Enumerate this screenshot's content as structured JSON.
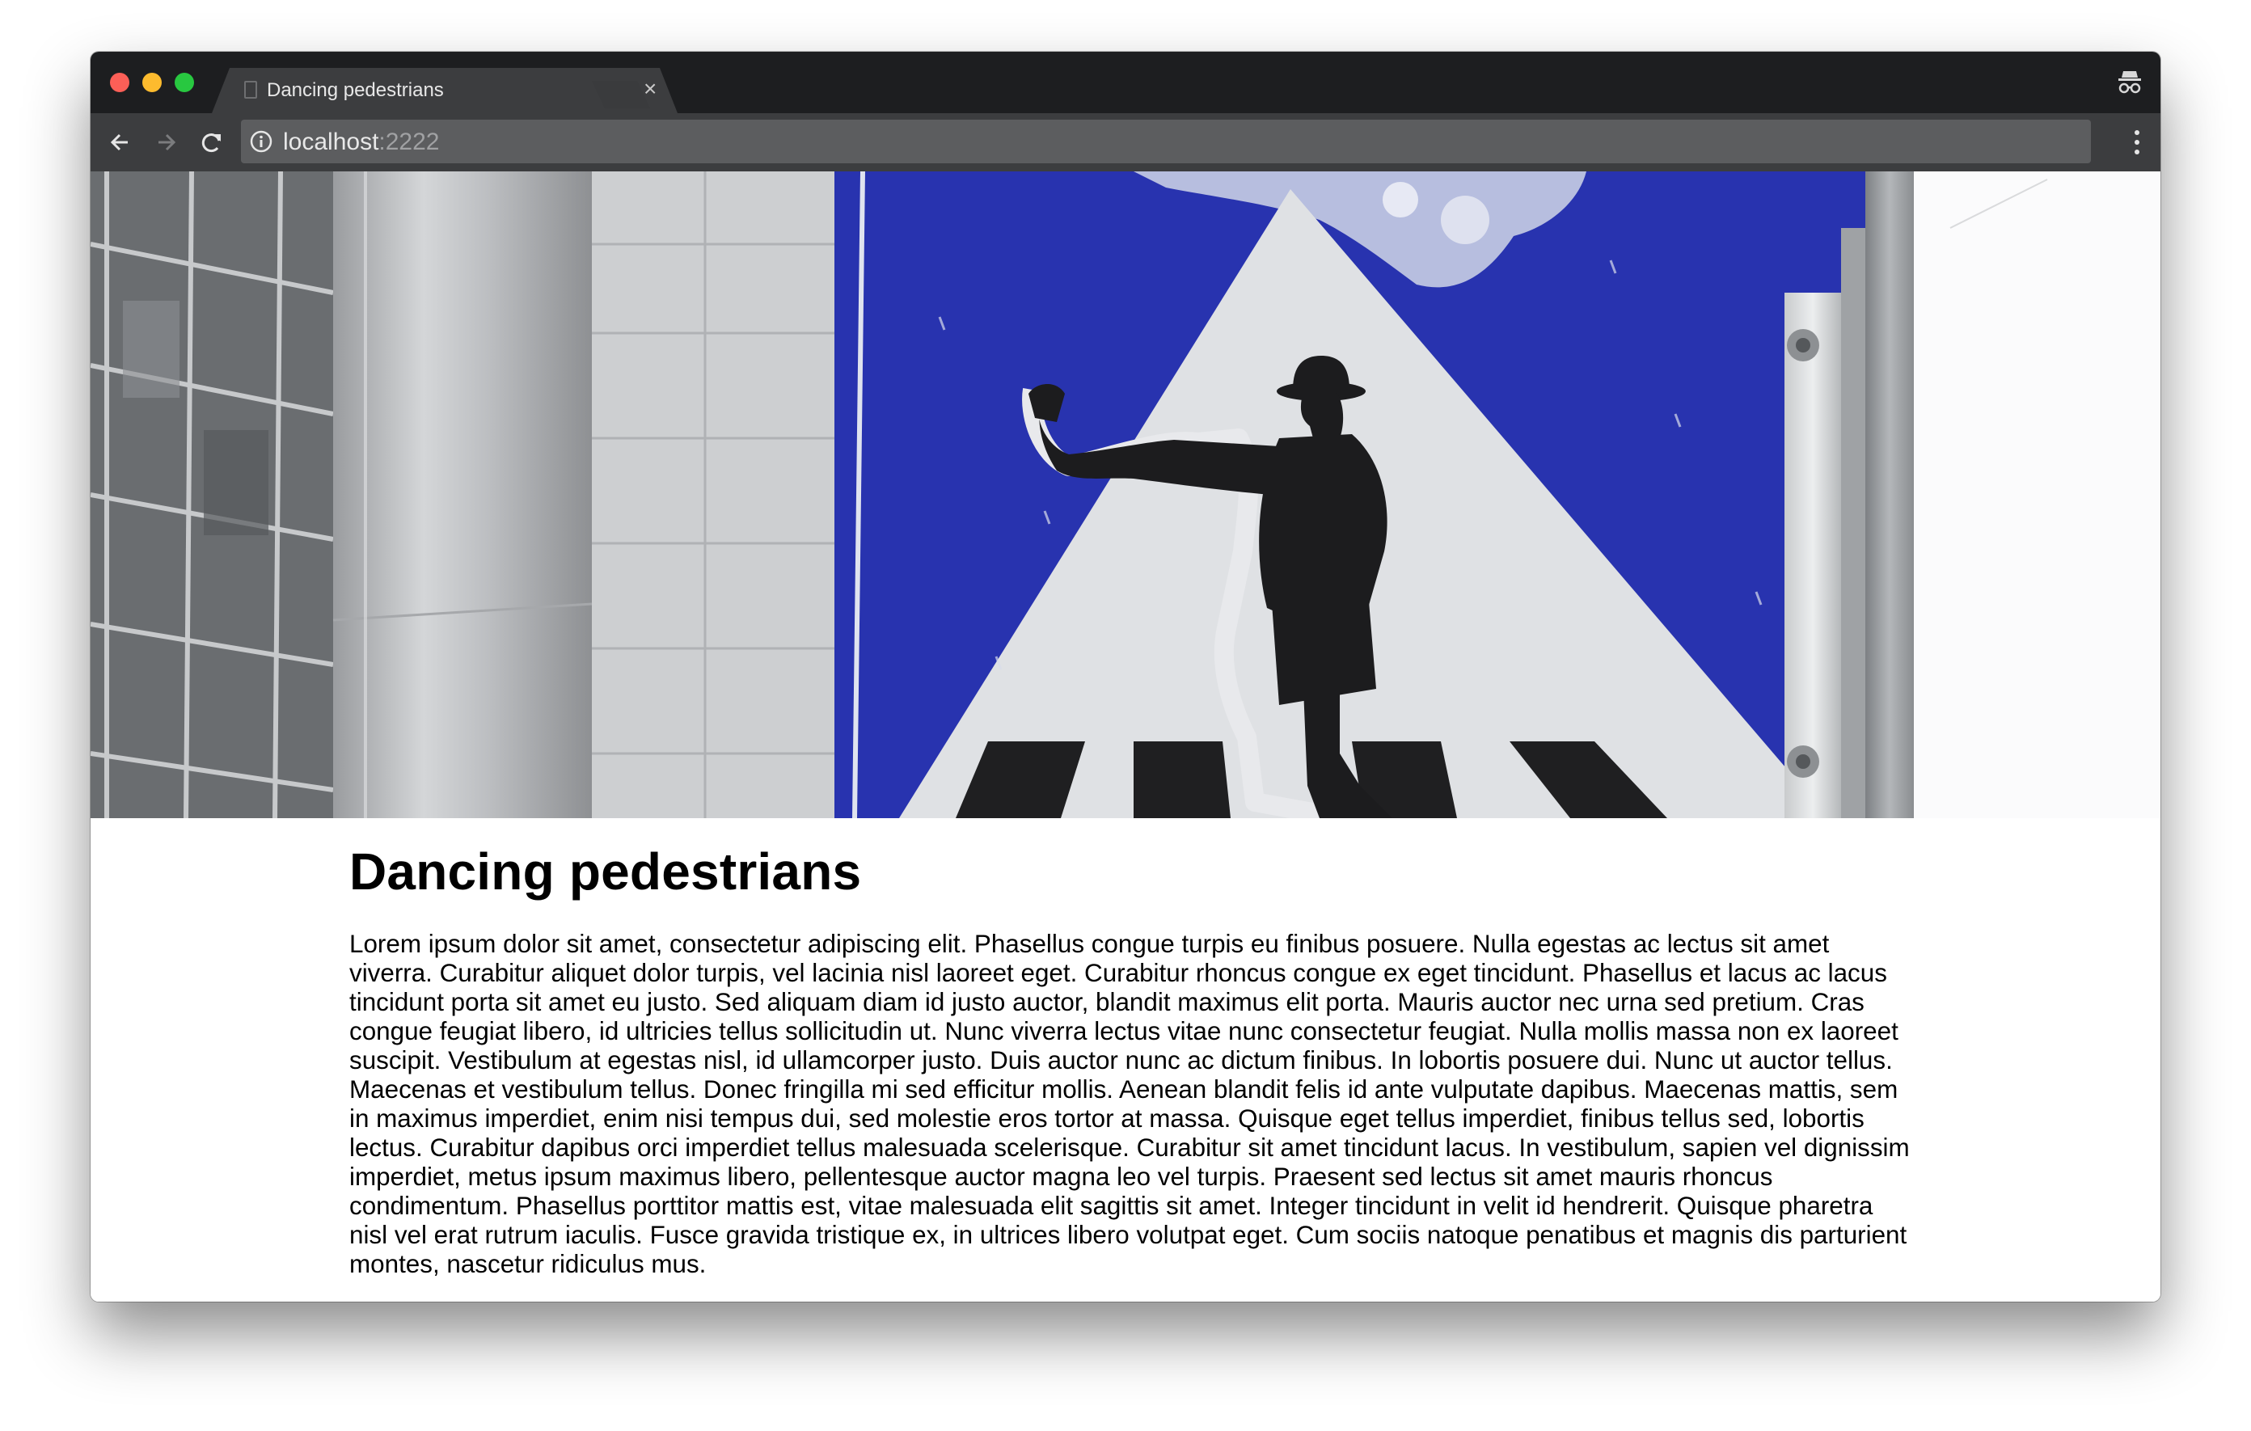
{
  "tab": {
    "title": "Dancing pedestrians",
    "close_glyph": "×"
  },
  "toolbar": {
    "back_icon": "arrow-left-icon",
    "forward_icon": "arrow-right-icon",
    "reload_icon": "reload-icon",
    "url_host": "localhost",
    "url_port": ":2222",
    "menu_icon": "kebab-menu-icon",
    "incognito_icon": "incognito-icon"
  },
  "hero": {
    "subject": "pedestrian crossing sign with a silly-walking figure"
  },
  "article": {
    "heading": "Dancing pedestrians",
    "body": "Lorem ipsum dolor sit amet, consectetur adipiscing elit. Phasellus congue turpis eu finibus posuere. Nulla egestas ac lectus sit amet viverra. Curabitur aliquet dolor turpis, vel lacinia nisl laoreet eget. Curabitur rhoncus congue ex eget tincidunt. Phasellus et lacus ac lacus tincidunt porta sit amet eu justo. Sed aliquam diam id justo auctor, blandit maximus elit porta. Mauris auctor nec urna sed pretium. Cras congue feugiat libero, id ultricies tellus sollicitudin ut. Nunc viverra lectus vitae nunc consectetur feugiat. Nulla mollis massa non ex laoreet suscipit. Vestibulum at egestas nisl, id ullamcorper justo. Duis auctor nunc ac dictum finibus. In lobortis posuere dui. Nunc ut auctor tellus. Maecenas et vestibulum tellus. Donec fringilla mi sed efficitur mollis. Aenean blandit felis id ante vulputate dapibus. Maecenas mattis, sem in maximus imperdiet, enim nisi tempus dui, sed molestie eros tortor at massa. Quisque eget tellus imperdiet, finibus tellus sed, lobortis lectus. Curabitur dapibus orci imperdiet tellus malesuada scelerisque. Curabitur sit amet tincidunt lacus. In vestibulum, sapien vel dignissim imperdiet, metus ipsum maximus libero, pellentesque auctor magna leo vel turpis. Praesent sed lectus sit amet mauris rhoncus condimentum. Phasellus porttitor mattis est, vitae malesuada elit sagittis sit amet. Integer tincidunt in velit id hendrerit. Quisque pharetra nisl vel erat rutrum iaculis. Fusce gravida tristique ex, in ultrices libero volutpat eget. Cum sociis natoque penatibus et magnis dis parturient montes, nascetur ridiculus mus."
  },
  "colors": {
    "tabstrip": "#1d1e20",
    "toolbar": "#3c3d3f",
    "sign_blue": "#2b36b6"
  }
}
